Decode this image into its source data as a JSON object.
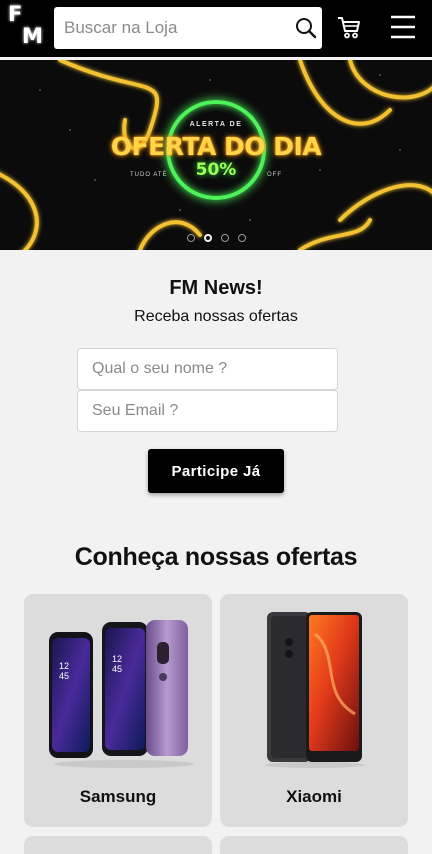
{
  "header": {
    "logo_letters": [
      "F",
      "M"
    ],
    "search_placeholder": "Buscar na Loja",
    "icons": [
      "search-icon",
      "cart-icon",
      "menu-icon"
    ]
  },
  "banner": {
    "alert_label": "ALERTA DE",
    "title": "OFERTA DO DIA",
    "percent": "50%",
    "left_text": "TUDO ATÉ",
    "right_text": "OFF",
    "slide_count": 4,
    "active_slide": 2
  },
  "newsletter": {
    "title": "FM News!",
    "subtitle": "Receba nossas ofertas",
    "name_placeholder": "Qual o seu nome ?",
    "email_placeholder": "Seu Email ?",
    "button_label": "Participe Já"
  },
  "offers": {
    "title": "Conheça nossas ofertas",
    "items": [
      {
        "name": "Samsung"
      },
      {
        "name": "Xiaomi"
      }
    ]
  },
  "colors": {
    "header_bg": "#000000",
    "page_bg": "#f2f2f2",
    "card_bg": "#dcdcdc",
    "neon_green": "#4ef25a",
    "neon_yellow": "#ffd64a"
  }
}
